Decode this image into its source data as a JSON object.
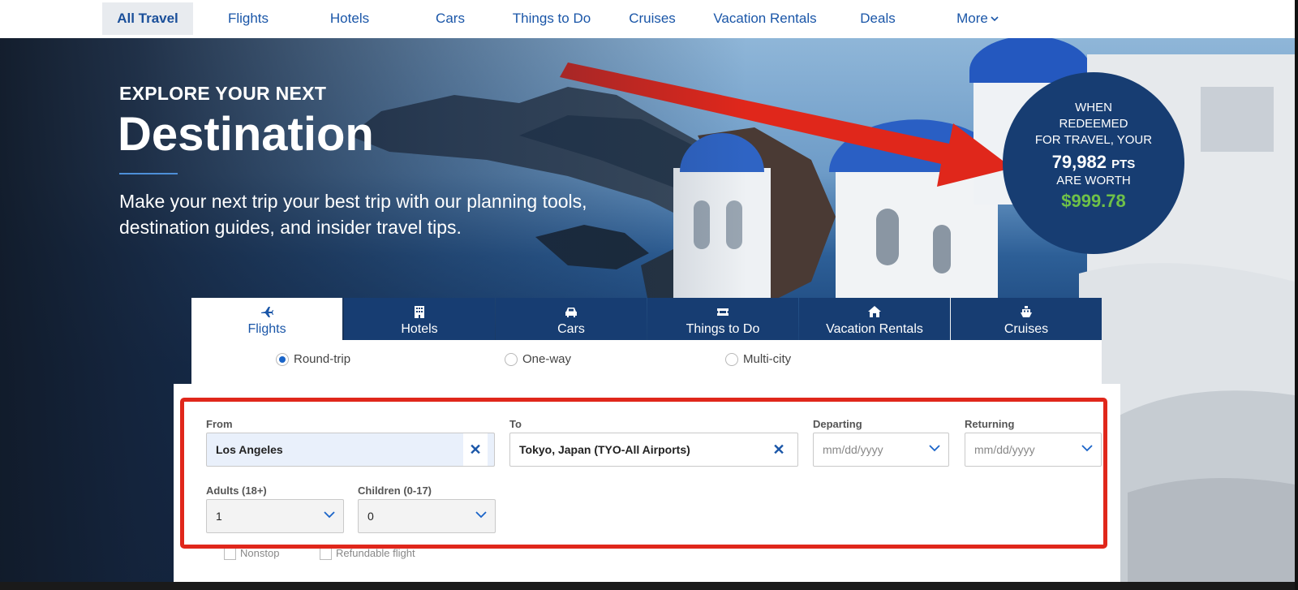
{
  "nav": {
    "items": [
      {
        "label": "All Travel",
        "active": true
      },
      {
        "label": "Flights"
      },
      {
        "label": "Hotels"
      },
      {
        "label": "Cars"
      },
      {
        "label": "Things to Do"
      },
      {
        "label": "Cruises"
      },
      {
        "label": "Vacation Rentals"
      },
      {
        "label": "Deals"
      },
      {
        "label": "More"
      }
    ]
  },
  "hero": {
    "subtitle": "EXPLORE YOUR NEXT",
    "title": "Destination",
    "description": "Make your next trip your best trip with our planning tools, destination guides, and insider travel tips."
  },
  "points": {
    "line1": "WHEN",
    "line2": "REDEEMED",
    "line3": "FOR TRAVEL, YOUR",
    "amount": "79,982",
    "unit": "PTS",
    "line4": "ARE WORTH",
    "value": "$999.78",
    "value_color": "#6fc148"
  },
  "tabs": [
    {
      "label": "Flights",
      "icon": "airplane-icon",
      "active": true
    },
    {
      "label": "Hotels",
      "icon": "building-icon"
    },
    {
      "label": "Cars",
      "icon": "car-icon"
    },
    {
      "label": "Things to Do",
      "icon": "ticket-icon"
    },
    {
      "label": "Vacation Rentals",
      "icon": "house-icon"
    },
    {
      "label": "Cruises",
      "icon": "ship-icon"
    }
  ],
  "trip_types": [
    {
      "label": "Round-trip",
      "selected": true
    },
    {
      "label": "One-way",
      "selected": false
    },
    {
      "label": "Multi-city",
      "selected": false
    }
  ],
  "form": {
    "from_label": "From",
    "from_value": "Los Angeles",
    "to_label": "To",
    "to_value": "Tokyo, Japan (TYO-All Airports)",
    "departing_label": "Departing",
    "departing_placeholder": "mm/dd/yyyy",
    "returning_label": "Returning",
    "returning_placeholder": "mm/dd/yyyy",
    "adults_label": "Adults (18+)",
    "adults_value": "1",
    "children_label": "Children (0-17)",
    "children_value": "0",
    "clear_symbol": "✕"
  },
  "options": {
    "nonstop": "Nonstop",
    "refundable": "Refundable flight"
  },
  "colors": {
    "nav_link": "#1a56a8",
    "tab_bg": "#173d72",
    "highlight": "#e0271b",
    "arrow": "#e0271b"
  }
}
